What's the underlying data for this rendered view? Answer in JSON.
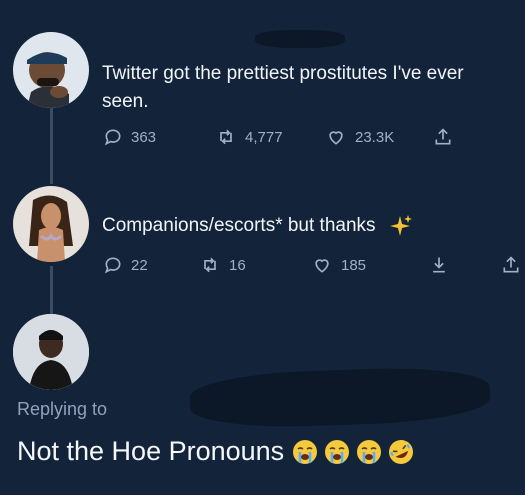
{
  "tweet1": {
    "text": "Twitter got the prettiest prostitutes I've ever seen.",
    "replies": "363",
    "retweets": "4,777",
    "likes": "23.3K"
  },
  "tweet2": {
    "text": "Companions/escorts* but thanks",
    "replies": "22",
    "retweets": "16",
    "likes": "185"
  },
  "tweet3": {
    "replying_to": "Replying to",
    "text": "Not the Hoe Pronouns"
  },
  "colors": {
    "background": "#13233a",
    "text": "#f1f5fa",
    "muted": "#9fb1c6",
    "sparkle": "#f4c430"
  },
  "icons": [
    "reply-icon",
    "retweet-icon",
    "like-icon",
    "share-icon",
    "download-icon",
    "sparkles-icon",
    "crying-face-emoji",
    "rofl-emoji"
  ]
}
